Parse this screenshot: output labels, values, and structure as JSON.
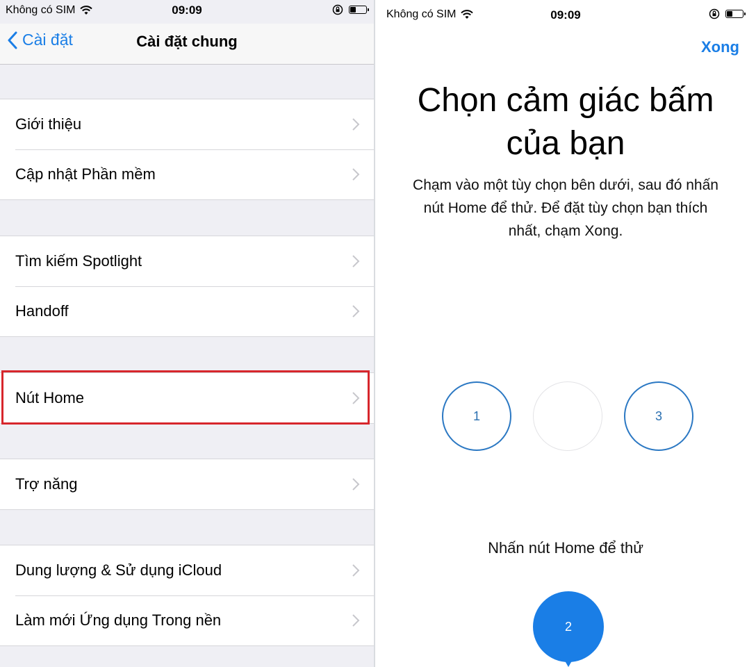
{
  "colors": {
    "accent": "#1a7ee6",
    "highlight_border": "#d7262c",
    "ring": "#2b78c3"
  },
  "left": {
    "status": {
      "carrier": "Không có SIM",
      "time": "09:09"
    },
    "nav": {
      "back_label": "Cài đặt",
      "title": "Cài đặt chung"
    },
    "groups": [
      {
        "items": [
          {
            "label": "Giới thiệu"
          },
          {
            "label": "Cập nhật Phần mềm"
          }
        ]
      },
      {
        "items": [
          {
            "label": "Tìm kiếm Spotlight"
          },
          {
            "label": "Handoff"
          }
        ]
      },
      {
        "items": [
          {
            "label": "Nút Home",
            "highlighted": true
          }
        ]
      },
      {
        "items": [
          {
            "label": "Trợ năng"
          }
        ]
      },
      {
        "items": [
          {
            "label": "Dung lượng & Sử dụng iCloud"
          },
          {
            "label": "Làm mới Ứng dụng Trong nền"
          }
        ]
      }
    ]
  },
  "right": {
    "status": {
      "carrier": "Không có SIM",
      "time": "09:09"
    },
    "done_label": "Xong",
    "headline_line1": "Chọn cảm giác bấm",
    "headline_line2": "của bạn",
    "description": "Chạm vào một tùy chọn bên dưới, sau đó nhấn nút Home để thử. Để đặt tùy chọn bạn thích nhất, chạm Xong.",
    "options": [
      {
        "label": "1"
      },
      {
        "label": ""
      },
      {
        "label": "3"
      }
    ],
    "hint": "Nhấn nút Home để thử",
    "selected_label": "2"
  }
}
